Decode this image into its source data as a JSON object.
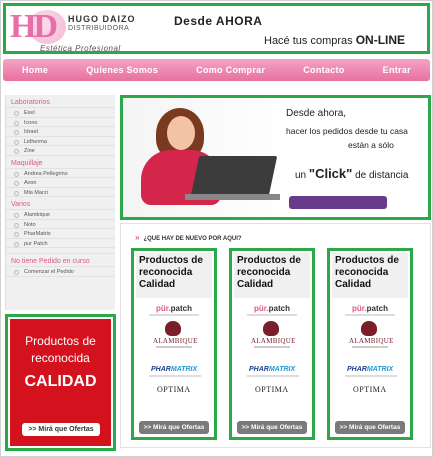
{
  "header": {
    "logo_letters": "HD",
    "brand": "HUGO  DAIZO",
    "brand_sub": "DISTRIBUIDORA",
    "tagline": "Estética  Profesional",
    "title": "Desde AHORA",
    "subtitle_prefix": "Hacé tus compras ",
    "subtitle_strong": "ON-LINE"
  },
  "nav": {
    "items": [
      {
        "label": "Home"
      },
      {
        "label": "Quienes Somos"
      },
      {
        "label": "Como Comprar"
      },
      {
        "label": "Contacto"
      },
      {
        "label": "Entrar"
      }
    ]
  },
  "sidebar": {
    "categories": [
      {
        "label": "Laboratorios",
        "items": [
          "Exel",
          "Icono",
          "Idraet",
          "Lidherma",
          "Zine"
        ]
      },
      {
        "label": "Maquillaje",
        "items": [
          "Andrea Pellegrino",
          "Avon",
          "Mia Marzi"
        ]
      },
      {
        "label": "Varios",
        "items": [
          "Alambique",
          "Noto",
          "PharMatrix",
          "pur Patch"
        ]
      }
    ],
    "order_title": "No tiene Pedido en curso",
    "order_link": "Comenzar el Pedido"
  },
  "ad_left": {
    "line1": "Productos de reconocida",
    "line2": "CALIDAD",
    "button": ">> Mirá que Ofertas"
  },
  "banner": {
    "line1": "Desde ahora,",
    "line2": "hacer los pedidos desde tu casa",
    "line3": "están a sólo",
    "line4_pre": "un ",
    "line4_strong": "\"Click\"",
    "line4_post": " de distancia"
  },
  "whatsnew": {
    "title": "¿QUE HAY DE NUEVO POR AQUI?",
    "cards": [
      {
        "title": "Productos de reconocida Calidad",
        "button": ">> Mirá que Ofertas"
      },
      {
        "title": "Productos de reconocida Calidad",
        "button": ">> Mirá que Ofertas"
      },
      {
        "title": "Productos de reconocida Calidad",
        "button": ">> Mirá que Ofertas"
      }
    ],
    "brands": {
      "pur_a": "pür.",
      "pur_b": "patch",
      "alambique": "ALAMBIQUE",
      "pharma_a": "PHAR",
      "pharma_b": "MATRIX",
      "optima": "OPTIMA"
    }
  },
  "colors": {
    "accent_pink": "#e76ea8",
    "highlight_green": "#2aa84a",
    "ad_red": "#d4121d",
    "banner_button_purple": "#6a3a8a"
  }
}
